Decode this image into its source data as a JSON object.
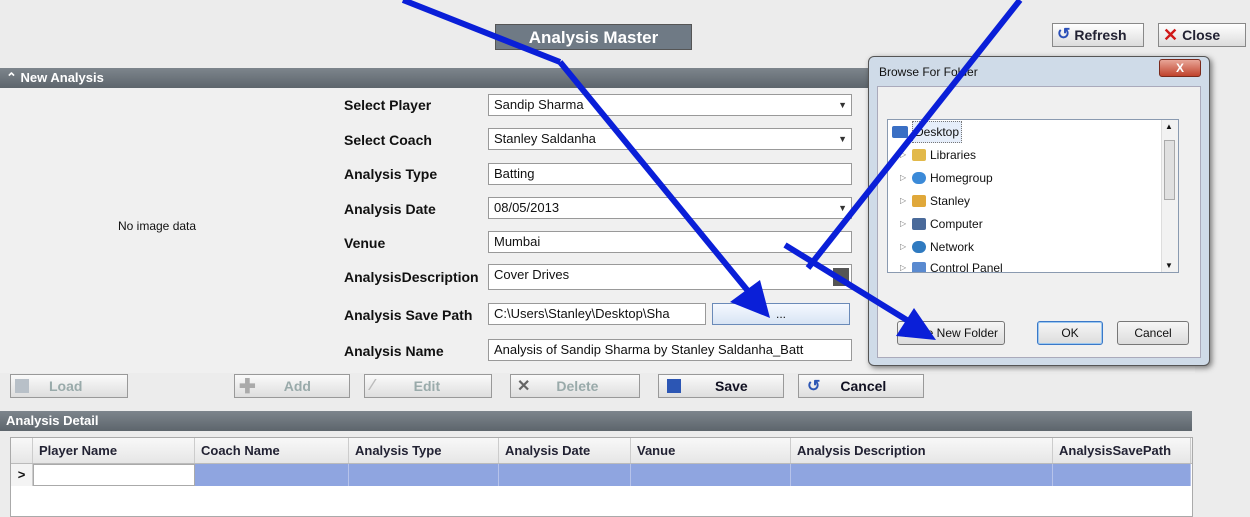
{
  "header": {
    "title": "Analysis Master",
    "refresh_label": "Refresh",
    "close_label": "Close"
  },
  "new_analysis": {
    "section_title": "New Analysis",
    "image_placeholder": "No image data",
    "fields": {
      "player": {
        "label": "Select Player",
        "value": "Sandip Sharma"
      },
      "coach": {
        "label": "Select Coach",
        "value": "Stanley Saldanha"
      },
      "type": {
        "label": "Analysis Type",
        "value": "Batting"
      },
      "date": {
        "label": "Analysis Date",
        "value": "08/05/2013"
      },
      "venue": {
        "label": "Venue",
        "value": "Mumbai"
      },
      "description": {
        "label": "AnalysisDescription",
        "value": "Cover Drives"
      },
      "save_path": {
        "label": "Analysis Save Path",
        "value": "C:\\Users\\Stanley\\Desktop\\Sha",
        "browse_label": "..."
      },
      "name": {
        "label": "Analysis Name",
        "value": "Analysis of Sandip Sharma by Stanley Saldanha_Batt"
      }
    },
    "actions": {
      "load": "Load",
      "add": "Add",
      "edit": "Edit",
      "delete": "Delete",
      "save": "Save",
      "cancel": "Cancel"
    }
  },
  "analysis_detail": {
    "section_title": "Analysis Detail",
    "columns": [
      "Player Name",
      "Coach Name",
      "Analysis Type",
      "Analysis Date",
      "Vanue",
      "Analysis Description",
      "AnalysisSavePath"
    ],
    "row_indicator": ">"
  },
  "browse_dialog": {
    "title": "Browse For Folder",
    "close_label": "X",
    "tree": [
      "Desktop",
      "Libraries",
      "Homegroup",
      "Stanley",
      "Computer",
      "Network",
      "Control Panel"
    ],
    "new_folder_label": "Make New Folder",
    "ok_label": "OK",
    "cancel_label": "Cancel"
  },
  "colors": {
    "annotation_arrow": "#0a1fd8",
    "selected_row": "#8fa5e0",
    "section_bar": "#6a727a"
  }
}
